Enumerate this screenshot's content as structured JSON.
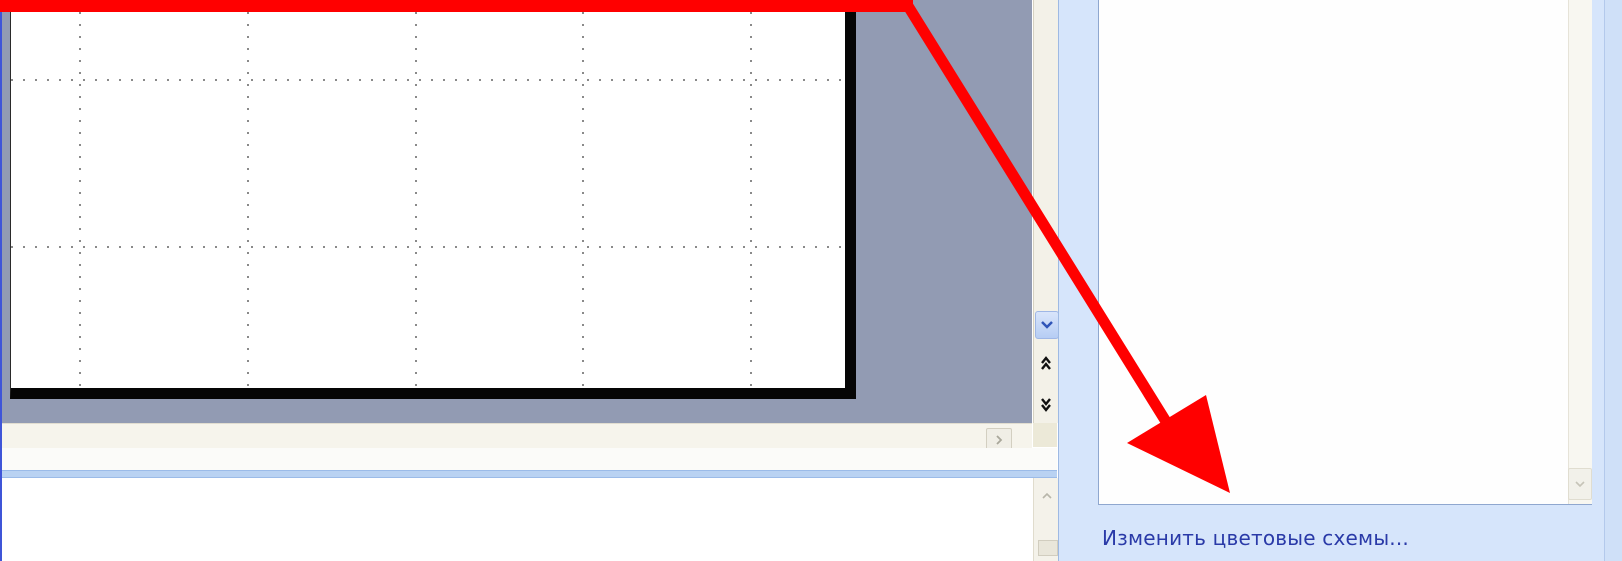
{
  "task_pane": {
    "link_text": "Изменить цветовые схемы..."
  },
  "colors": {
    "workspace": "#929bb3",
    "task_pane": "#d6e5fb",
    "annotation": "#ff0000",
    "link": "#2a3aa8"
  },
  "icons": {
    "vscroll_down": "chevron-down-icon",
    "prev_slide": "double-up-icon",
    "next_slide": "double-down-icon",
    "hscroll_right": "chevron-right-icon",
    "notes_up": "chevron-up-icon",
    "list_down": "chevron-down-icon"
  }
}
